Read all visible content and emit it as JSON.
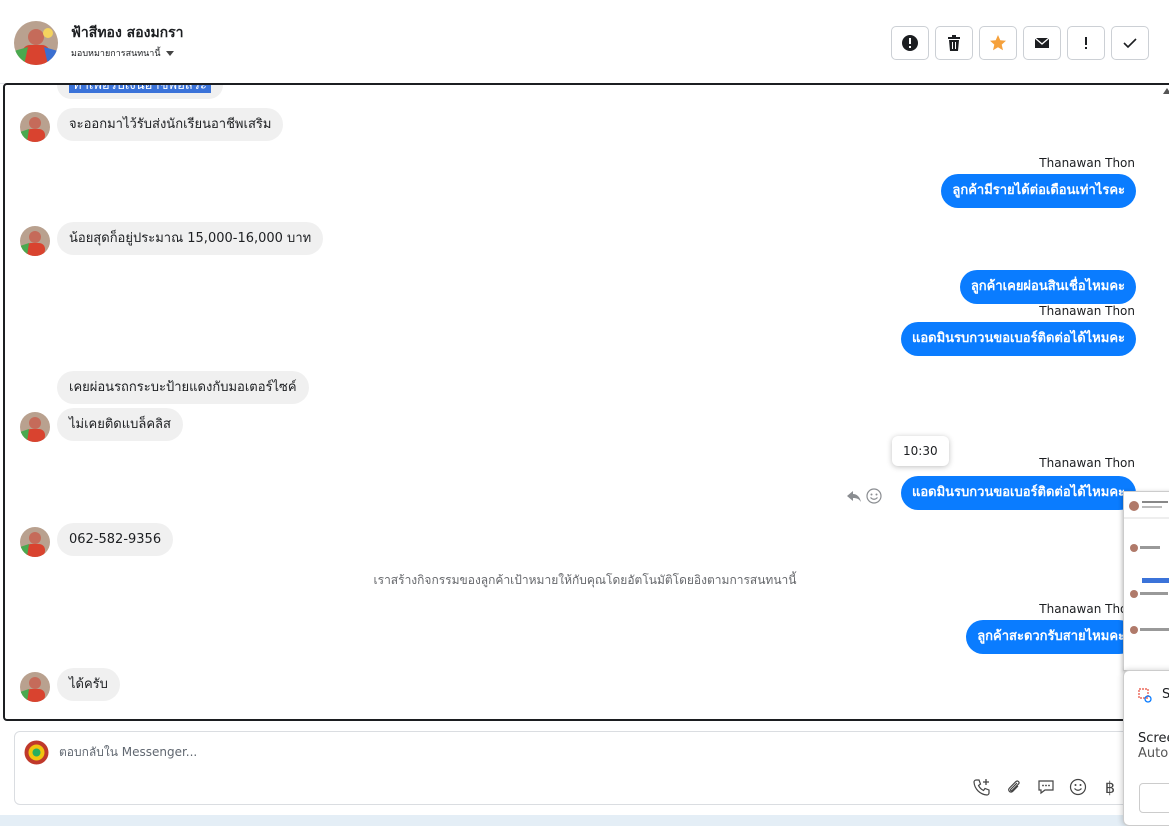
{
  "header": {
    "contact_name": "ฟ้าสีทอง สองมกรา",
    "assign_label": "มอบหมายการสนทนานี้",
    "actions": [
      {
        "icon": "alert-circle-icon",
        "label": "report"
      },
      {
        "icon": "trash-icon",
        "label": "delete"
      },
      {
        "icon": "star-icon",
        "label": "star"
      },
      {
        "icon": "mail-icon",
        "label": "mark unread"
      },
      {
        "icon": "exclamation-icon",
        "label": "spam"
      },
      {
        "icon": "check-icon",
        "label": "done"
      }
    ]
  },
  "colors": {
    "accent": "#0a7cff",
    "incoming_bubble": "#f0f0f0",
    "star": "#f5a13c",
    "highlight": "#3b73d9"
  },
  "messages": {
    "partial_top": "ทำเพื่อรับเงินอาชีพอิสระ",
    "m1": "จะออกมาไว้รับส่งนักเรียนอาชีพเสริม",
    "s1": "Thanawan Thon",
    "m2": "ลูกค้ามีรายได้ต่อเดือนเท่าไรคะ",
    "m3": "น้อยสุดก็อยู่ประมาณ 15,000-16,000 บาท",
    "m4": "ลูกค้าเคยผ่อนสินเชื่อไหมคะ",
    "s2": "Thanawan Thon",
    "m5": "แอดมินรบกวนขอเบอร์ติดต่อได้ไหมคะ",
    "m6": "เคยผ่อนรถกระบะป้ายแดงกับมอเตอร์ไซค์",
    "m7": "ไม่เคยติดแบล็คลิส",
    "tooltip_time": "10:30",
    "s3": "Thanawan Thon",
    "m8": "แอดมินรบกวนขอเบอร์ติดต่อได้ไหมคะ",
    "m9": "062-582-9356",
    "system_note": "เราสร้างกิจกรรมของลูกค้าเป้าหมายให้กับคุณโดยอัตโนมัติโดยอิงตามการสนทนานี้",
    "s4": "Thanawan Thon",
    "m10": "ลูกค้าสะดวกรับสายไหมคะ",
    "m11": "ได้ครับ"
  },
  "reply": {
    "placeholder": "ตอบกลับใน Messenger...",
    "tools": [
      "phone-plus-icon",
      "paperclip-icon",
      "chat-icon",
      "emoji-icon",
      "baht-icon"
    ],
    "baht_symbol": "฿"
  },
  "overlay": {
    "popup_title": "S",
    "popup_line1": "Scree",
    "popup_line2": "Auto"
  }
}
